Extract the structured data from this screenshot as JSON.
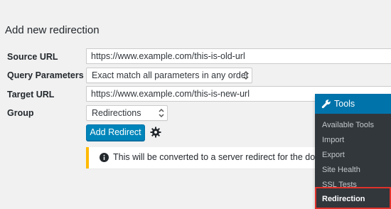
{
  "page": {
    "heading": "Add new redirection"
  },
  "form": {
    "source_url_label": "Source URL",
    "source_url_value": "https://www.example.com/this-is-old-url",
    "query_params_label": "Query Parameters",
    "query_params_value": "Exact match all parameters in any order",
    "target_url_label": "Target URL",
    "target_url_value": "https://www.example.com/this-is-new-url",
    "group_label": "Group",
    "group_value": "Redirections",
    "add_redirect_label": "Add Redirect"
  },
  "notice": {
    "text": "This will be converted to a server redirect for the domain"
  },
  "flyout": {
    "header_label": "Tools",
    "items": [
      {
        "label": "Available Tools"
      },
      {
        "label": "Import"
      },
      {
        "label": "Export"
      },
      {
        "label": "Site Health"
      },
      {
        "label": "SSL Tests"
      },
      {
        "label": "Redirection"
      }
    ],
    "active_item": "Redirection"
  },
  "colors": {
    "primary_button": "#0085ba",
    "flyout_bg": "#32373c",
    "flyout_header": "#0073aa",
    "notice_border": "#ffb900",
    "highlight": "#e0312b"
  },
  "icons": [
    "gear-icon",
    "info-icon",
    "wrench-icon",
    "chevron-updown-icon"
  ]
}
